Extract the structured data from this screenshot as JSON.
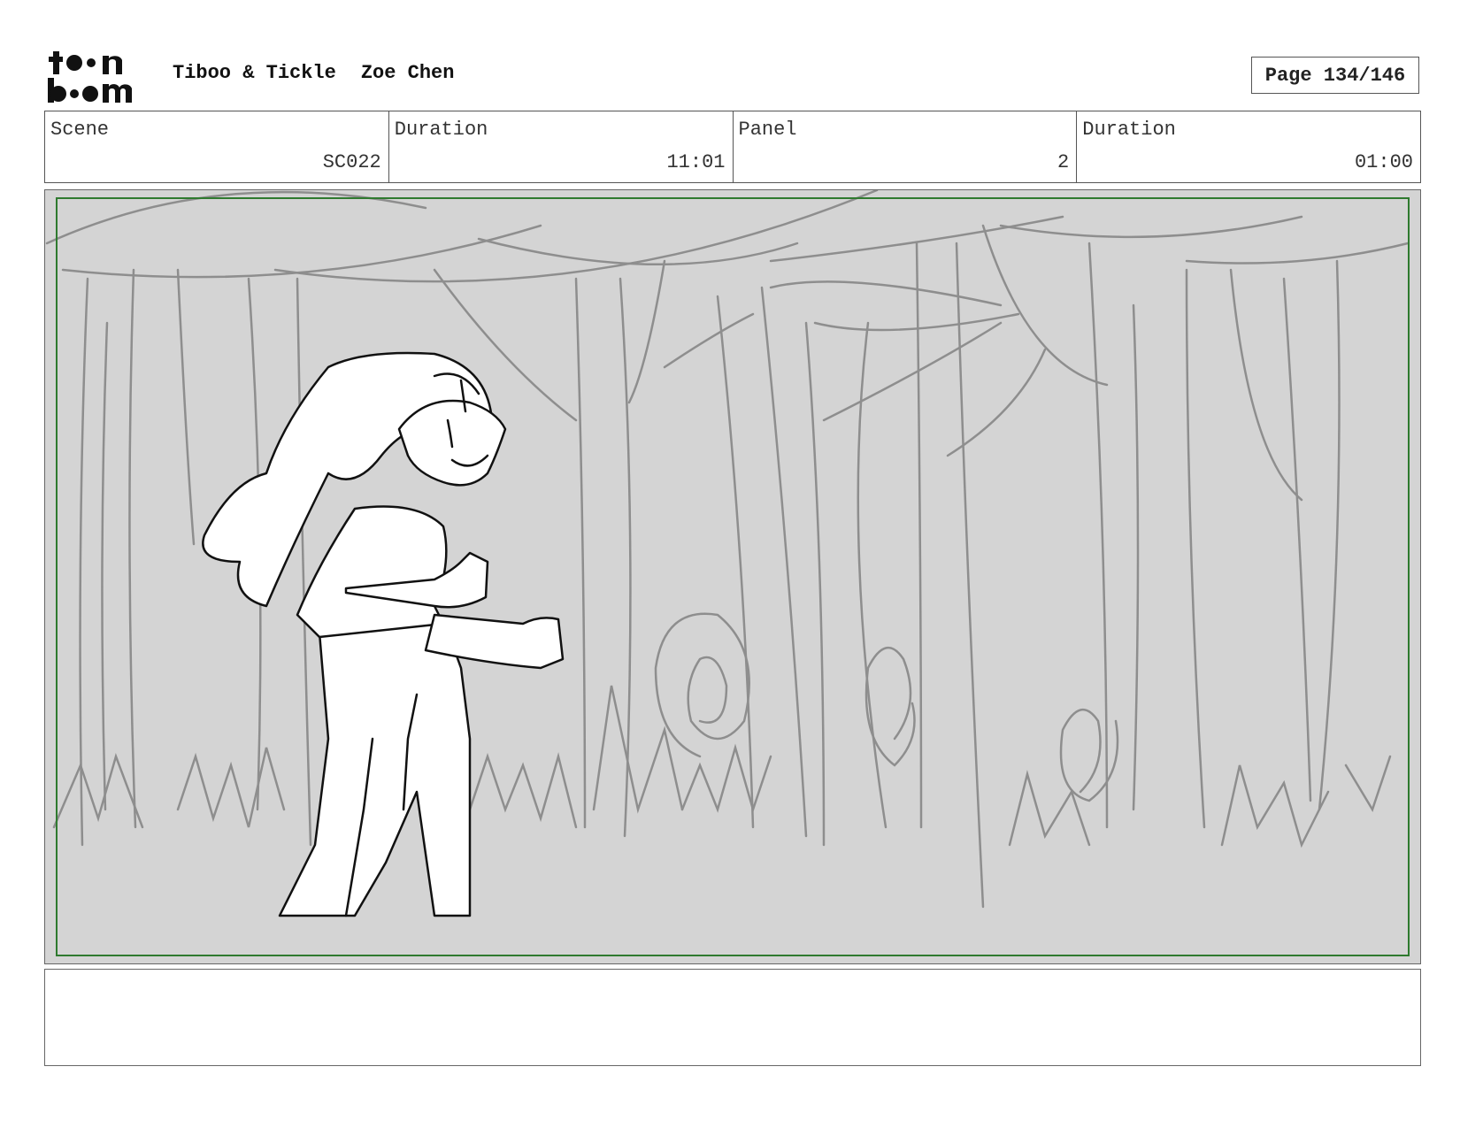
{
  "header": {
    "logo_text": "toon boom",
    "project": "Tiboo & Tickle",
    "author": "Zoe Chen",
    "page": "Page 134/146"
  },
  "info": {
    "scene_label": "Scene",
    "scene_value": "SC022",
    "scene_duration_label": "Duration",
    "scene_duration_value": "11:01",
    "panel_label": "Panel",
    "panel_value": "2",
    "panel_duration_label": "Duration",
    "panel_duration_value": "01:00"
  },
  "panel": {
    "background_color": "#d4d4d4",
    "safe_frame_color": "#2f7a2f"
  },
  "notes": {
    "text": ""
  }
}
